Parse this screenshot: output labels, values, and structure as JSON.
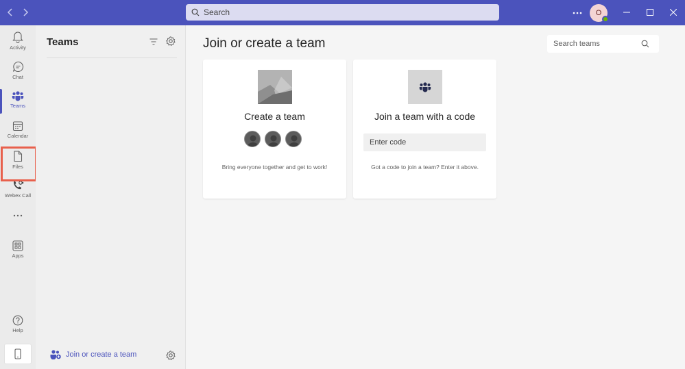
{
  "header": {
    "search_placeholder": "Search",
    "avatar_initial": "O"
  },
  "rail": {
    "items": [
      {
        "label": "Activity",
        "icon": "bell-icon"
      },
      {
        "label": "Chat",
        "icon": "chat-icon"
      },
      {
        "label": "Teams",
        "icon": "teams-icon",
        "active": true
      },
      {
        "label": "Calendar",
        "icon": "calendar-icon"
      },
      {
        "label": "Files",
        "icon": "file-icon"
      },
      {
        "label": "Webex Call",
        "icon": "webex-call-icon"
      },
      {
        "label": "Apps",
        "icon": "apps-icon"
      },
      {
        "label": "Help",
        "icon": "help-icon"
      }
    ],
    "more_label": "..."
  },
  "teams_pane": {
    "title": "Teams",
    "join_label": "Join or create a team"
  },
  "main": {
    "title": "Join or create a team",
    "search_placeholder": "Search teams",
    "create_card": {
      "title": "Create a team",
      "description": "Bring everyone together and get to work!"
    },
    "join_card": {
      "title": "Join a team with a code",
      "code_placeholder": "Enter code",
      "description": "Got a code to join a team? Enter it above."
    }
  },
  "colors": {
    "brand": "#4b53bc",
    "highlight": "#e8604c"
  }
}
